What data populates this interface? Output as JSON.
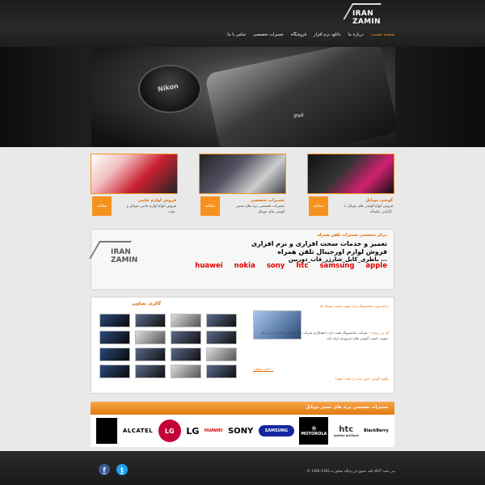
{
  "header": {
    "logo_text": "IRAN ZAMIN",
    "nav": [
      "صفحه نخست",
      "درباره ما",
      "دانلود نرم افزار",
      "فروشگاه",
      "تعمیرات تخصصی",
      "تماس با ما"
    ]
  },
  "hero": {
    "lens_text": "Nikon",
    "device_text": "iPad"
  },
  "features": [
    {
      "title": "فروش لوازم جانبی",
      "desc": "فروش انواع لوازم جانبی موبایل و تبلت.",
      "btn": "مطالعه"
    },
    {
      "title": "تعمیرات تخصصی",
      "desc": "تعمیرات تخصصی برند های معتبر گوشی های موبایل",
      "btn": "مطالعه"
    },
    {
      "title": "گوشی موبایل",
      "desc": "فروش انواع گوشی های موبایل با گارانتی یکساله.",
      "btn": "مطالعه"
    }
  ],
  "info": {
    "head": "مرکز تخصصی تعمیرات تلفن همراه",
    "line1": "تعمیر و خدمات سخت افزاری و نرم افزاری",
    "line2": "فروش لوازم اورجینال تلفن همراه",
    "line3": "باطری_کابل_شارژر_قاب_دوربین ...",
    "brands": [
      "apple",
      "samsung",
      "htc",
      "sony",
      "nokia",
      "huawei"
    ],
    "logo_text": "IRAN ZAMIN"
  },
  "gallery": {
    "title": "گالری تصاویر"
  },
  "news": {
    "head": "برنامه ویژه سامسونگ برای تقویت امنیت موبایل ها",
    "body_hl": "آی تی رسان",
    "body": "– شرکت سامسونگ قصد دارد با همکاری شرکت های امنیتی برنامه ای را برای تقویت امنیت گوشی های اندرویدی ارائه کند.",
    "more": "ادامه مطلب...",
    "second_head": "چگونه گوشی خیس شده را نجات دهیم؟"
  },
  "brands": {
    "title": "تعمیرات تخصصی برند های معتبر موبایل",
    "items": [
      "",
      "ALCATEL",
      "LG",
      "LG",
      "HUAWEI",
      "SONY",
      "SAMSUNG",
      "MOTOROLA",
      "htc",
      "quietly brilliant",
      "BlackBerry"
    ]
  },
  "footer": {
    "copyright": "© 1394-1393 کلیه حقوق این پایگاه متعلق به sbt7 می باشد."
  },
  "colors": {
    "accent": "#f6921e",
    "brand_red": "#e00000",
    "dark_bg": "#1c1c1c"
  }
}
